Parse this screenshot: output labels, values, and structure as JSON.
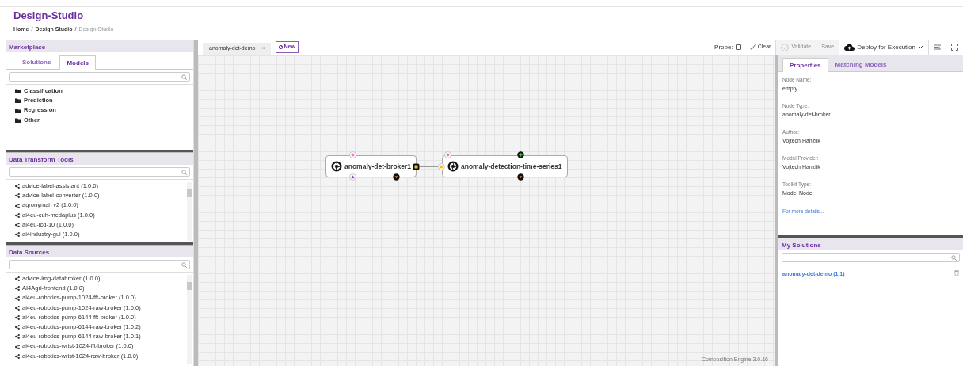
{
  "header": {
    "title": "Design-Studio",
    "breadcrumb": [
      {
        "label": "Home",
        "current": false
      },
      {
        "label": "Design Studio",
        "current": false,
        "separator": "/"
      },
      {
        "label": "Design-Studio",
        "current": true,
        "separator": "/"
      }
    ]
  },
  "marketplace": {
    "title": "Marketplace",
    "tabs": [
      {
        "label": "Solutions",
        "selected": false
      },
      {
        "label": "Models",
        "selected": true
      }
    ],
    "categories": [
      "Classification",
      "Prediction",
      "Regression",
      "Other"
    ]
  },
  "transform_tools": {
    "title": "Data Transform Tools",
    "items": [
      "advice-label-assistant (1.0.0)",
      "advice-label-converter (1.0.0)",
      "agronymai_v2 (1.0.0)",
      "ai4eu-cuh-medaplus (1.0.0)",
      "ai4eu-icd-10 (1.0.0)",
      "ai4industry-gui (1.0.0)"
    ]
  },
  "data_sources": {
    "title": "Data Sources",
    "items": [
      "advice-img-databroker (1.0.0)",
      "AI4Agri-frontend (1.0.0)",
      "ai4eu-robotics-pump-1024-fft-broker (1.0.0)",
      "ai4eu-robotics-pump-1024-raw-broker (1.0.0)",
      "ai4eu-robotics-pump-6144-fft-broker (1.0.0)",
      "ai4eu-robotics-pump-6144-raw-broker (1.0.2)",
      "ai4eu-robotics-pump-6144-raw-broker (1.0.1)",
      "ai4eu-robotics-wrist-1024-fft-broker (1.0.0)",
      "ai4eu-robotics-wrist-1024-raw-broker (1.0.0)"
    ]
  },
  "canvas": {
    "tabs": [
      {
        "label": "anomaly-det-demo",
        "close": "×"
      }
    ],
    "new_button": "New",
    "nodes": [
      {
        "label": "anomaly-det-broker1",
        "ports": [
          {
            "kind": "request"
          },
          {
            "kind": "response"
          },
          {
            "kind": "output",
            "connected": true
          },
          {
            "kind": "expand"
          }
        ]
      },
      {
        "label": "anomaly-detection-time-series1",
        "ports": [
          {
            "kind": "request"
          },
          {
            "kind": "add"
          },
          {
            "kind": "input"
          },
          {
            "kind": "expand"
          }
        ]
      }
    ],
    "footer": "Composition Engine 3.0.16"
  },
  "toolbar": {
    "probe_label": "Probe:",
    "probe_checked": false,
    "buttons": [
      {
        "kind": "clear",
        "label": "Clear",
        "disabled": false
      },
      {
        "kind": "validate",
        "label": "Validate",
        "disabled": true
      },
      {
        "kind": "save",
        "label": "Save",
        "disabled": true
      },
      {
        "kind": "deploy",
        "label": "Deploy for Execution",
        "disabled": false
      },
      {
        "kind": "layout",
        "disabled": false
      },
      {
        "kind": "fullscreen",
        "disabled": false
      }
    ]
  },
  "properties": {
    "tabs": [
      {
        "label": "Properties",
        "selected": true
      },
      {
        "label": "Matching Models",
        "selected": false
      }
    ],
    "fields": [
      {
        "label": "Node Name:",
        "value": "empty"
      },
      {
        "label": "Node Type:",
        "value": "anomaly-det-broker"
      },
      {
        "label": "Author:",
        "value": "Vojtech Hanzlik"
      },
      {
        "label": "Model Provider:",
        "value": "Vojtech Hanzlik"
      },
      {
        "label": "Toolkit Type:",
        "value": "Model Node"
      }
    ],
    "link": "For more details..."
  },
  "my_solutions": {
    "title": "My Solutions",
    "items": [
      {
        "label": "anomaly-det-demo (1.1)"
      }
    ]
  }
}
